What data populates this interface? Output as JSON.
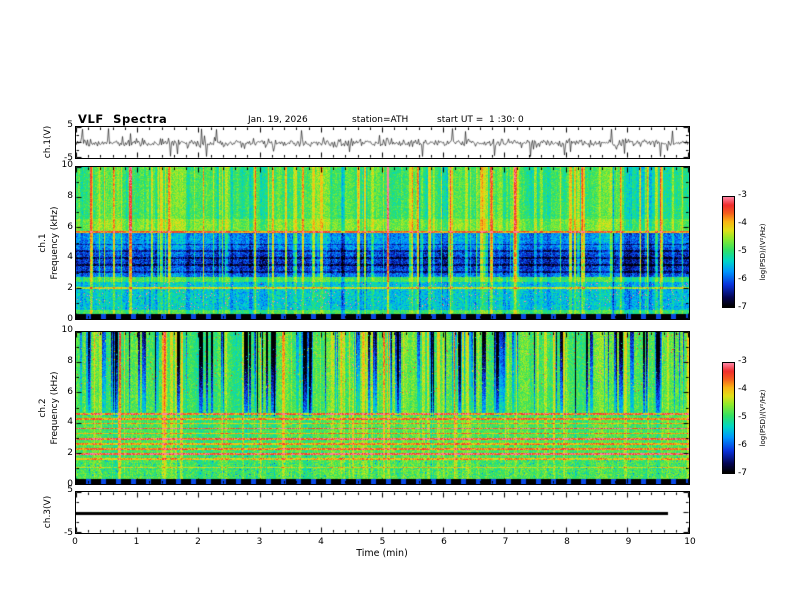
{
  "figure": {
    "title": "VLF  Spectra",
    "date": "Jan. 19, 2026",
    "station": "station=ATH",
    "start_ut": "start UT =  1 :30: 0",
    "xlabel": "Time  (min)",
    "x_range": [
      0,
      10
    ],
    "x_ticks": [
      0,
      1,
      2,
      3,
      4,
      5,
      6,
      7,
      8,
      9,
      10
    ],
    "background_color": "#ffffff",
    "axis_color": "#000000",
    "colormap": {
      "type": "jet-like, black at minimum",
      "stops": [
        [
          0.0,
          "#000000"
        ],
        [
          0.08,
          "#050550"
        ],
        [
          0.2,
          "#0a32dc"
        ],
        [
          0.32,
          "#0096ff"
        ],
        [
          0.42,
          "#00d7c8"
        ],
        [
          0.52,
          "#32e164"
        ],
        [
          0.62,
          "#8ceb2d"
        ],
        [
          0.7,
          "#e1e119"
        ],
        [
          0.78,
          "#fab414"
        ],
        [
          0.86,
          "#f55a1e"
        ],
        [
          0.93,
          "#f02d2d"
        ],
        [
          1.0,
          "#ff82a0"
        ]
      ]
    }
  },
  "chart_data": [
    {
      "type": "line",
      "name": "ch1-waveform",
      "ylabel": "ch.1(V)",
      "ylim": [
        -5,
        5
      ],
      "y_ticks": [
        5,
        -5
      ],
      "x_range": [
        0,
        10
      ],
      "line_color": "#000000",
      "description": "Broadband noisy voltage waveform of channel 1: mean about 0 V with continuous small fluctuations and frequent impulsive spikes reaching +/-5 V across the full 10-minute record."
    },
    {
      "type": "heatmap",
      "name": "ch1-spectrogram",
      "ylabel_lines": [
        "ch.1",
        "Frequency (kHz)"
      ],
      "ylim": [
        0,
        10
      ],
      "y_ticks": [
        0,
        2,
        4,
        6,
        8,
        10
      ],
      "x_range": [
        0,
        10
      ],
      "colorbar": {
        "label": "log(PSD)/(V²/Hz)",
        "range": [
          -7,
          -3
        ],
        "ticks": [
          -3,
          -4,
          -5,
          -6,
          -7
        ]
      },
      "description": "VLF power spectrogram, 0-10 kHz vs 0-10 min. Green background near -5 with dense vertical impulsive striations reaching yellow/red (-3.5); persistent blue low-power band between ~2.8 and 5.6 kHz with darker horizontal sub-bands; weaker bluish band 0.6-2.4 kHz with sparse red speckle; bright cyan narrow lines near 2.0 and 5.7 kHz; black dashed strip below ~0.3 kHz."
    },
    {
      "type": "heatmap",
      "name": "ch2-spectrogram",
      "ylabel_lines": [
        "ch.2",
        "Frequency (kHz)"
      ],
      "ylim": [
        0,
        10
      ],
      "y_ticks": [
        0,
        2,
        4,
        6,
        8,
        10
      ],
      "x_range": [
        0,
        10
      ],
      "colorbar": {
        "label": "log(PSD)/(V²/Hz)",
        "range": [
          -7,
          -3
        ],
        "ticks": [
          -3,
          -4,
          -5,
          -6,
          -7
        ]
      },
      "description": "VLF power spectrogram, 0-10 kHz vs 0-10 min. Green background; strong vertical striations above ~5 kHz alternating dark navy/black dropout columns and yellow bursts; a comb of narrow yellow-orange horizontal interference lines between ~1.0 and 4.7 kHz; fine green/cyan texture below 2 kHz; black dashed strip below ~0.3 kHz."
    },
    {
      "type": "line",
      "name": "ch3-flat",
      "ylabel": "ch.3(V)",
      "ylim": [
        -5,
        5
      ],
      "y_ticks": [
        5,
        -5
      ],
      "x_range": [
        0,
        10
      ],
      "line_color": "#000000",
      "description": "Channel 3 voltage is flat at 0 V - drawn as a thick black horizontal bar spanning 0 to about 9.7 min."
    }
  ]
}
